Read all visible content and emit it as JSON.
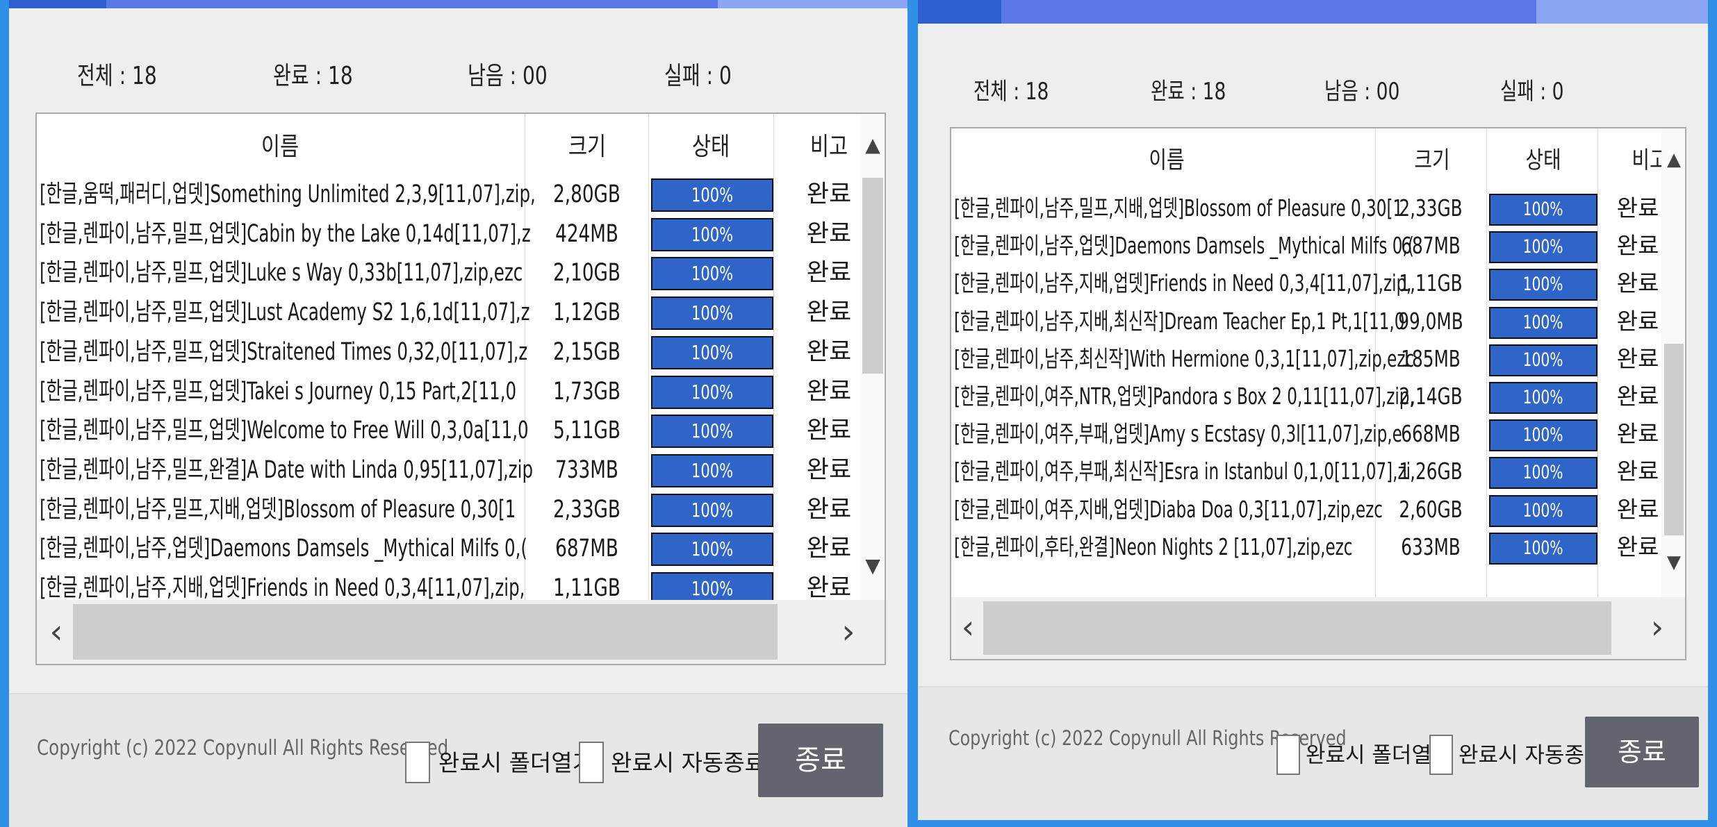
{
  "colors": {
    "accent": "#2f8ee6",
    "progress": "#2f65c8",
    "button": "#62656e"
  },
  "icons": {
    "scroll_up": "▲",
    "scroll_down": "▼",
    "scroll_left": "‹",
    "scroll_right": "›"
  },
  "left": {
    "stats": {
      "total": "전체 : 18",
      "done": "완료 : 18",
      "remain": "남음 : 00",
      "fail": "실패 : 0"
    },
    "columns": {
      "name": "이름",
      "size": "크기",
      "status": "상태",
      "note": "비고"
    },
    "rows": [
      {
        "name": "[한글,움떡,패러디,업뎃]Something Unlimited 2,3,9[11,07],zip,",
        "size": "2,80GB",
        "progress": "100%",
        "note": "완료"
      },
      {
        "name": "[한글,렌파이,남주,밀프,업뎃]Cabin by the Lake 0,14d[11,07],z",
        "size": "424MB",
        "progress": "100%",
        "note": "완료"
      },
      {
        "name": "[한글,렌파이,남주,밀프,업뎃]Luke s Way 0,33b[11,07],zip,ezc",
        "size": "2,10GB",
        "progress": "100%",
        "note": "완료"
      },
      {
        "name": "[한글,렌파이,남주,밀프,업뎃]Lust Academy S2 1,6,1d[11,07],z",
        "size": "1,12GB",
        "progress": "100%",
        "note": "완료"
      },
      {
        "name": "[한글,렌파이,남주,밀프,업뎃]Straitened Times 0,32,0[11,07],z",
        "size": "2,15GB",
        "progress": "100%",
        "note": "완료"
      },
      {
        "name": "[한글,렌파이,남주,밀프,업뎃]Takei s Journey 0,15 Part,2[11,0",
        "size": "1,73GB",
        "progress": "100%",
        "note": "완료"
      },
      {
        "name": "[한글,렌파이,남주,밀프,업뎃]Welcome to Free Will 0,3,0a[11,0",
        "size": "5,11GB",
        "progress": "100%",
        "note": "완료"
      },
      {
        "name": "[한글,렌파이,남주,밀프,완결]A Date with Linda 0,95[11,07],zip",
        "size": "733MB",
        "progress": "100%",
        "note": "완료"
      },
      {
        "name": "[한글,렌파이,남주,밀프,지배,업뎃]Blossom of Pleasure 0,30[1",
        "size": "2,33GB",
        "progress": "100%",
        "note": "완료"
      },
      {
        "name": "[한글,렌파이,남주,업뎃]Daemons Damsels _Mythical Milfs 0,(",
        "size": "687MB",
        "progress": "100%",
        "note": "완료"
      },
      {
        "name": "[한글,렌파이,남주,지배,업뎃]Friends in Need 0,3,4[11,07],zip,",
        "size": "1,11GB",
        "progress": "100%",
        "note": "완료"
      }
    ],
    "footer": {
      "copyright": "Copyright (c) 2022 Copynull All Rights Reserved",
      "open_folder": "완료시 폴더열기",
      "auto_exit": "완료시 자동종료",
      "exit_button": "종료"
    }
  },
  "right": {
    "stats": {
      "total": "전체 : 18",
      "done": "완료 : 18",
      "remain": "남음 : 00",
      "fail": "실패 : 0"
    },
    "columns": {
      "name": "이름",
      "size": "크기",
      "status": "상태",
      "note": "비고"
    },
    "rows": [
      {
        "name": "[한글,렌파이,남주,밀프,지배,업뎃]Blossom of Pleasure 0,30[1",
        "size": "2,33GB",
        "progress": "100%",
        "note": "완료"
      },
      {
        "name": "[한글,렌파이,남주,업뎃]Daemons Damsels _Mythical Milfs 0,(",
        "size": "687MB",
        "progress": "100%",
        "note": "완료"
      },
      {
        "name": "[한글,렌파이,남주,지배,업뎃]Friends in Need 0,3,4[11,07],zip,",
        "size": "1,11GB",
        "progress": "100%",
        "note": "완료"
      },
      {
        "name": "[한글,렌파이,남주,지배,최신작]Dream Teacher Ep,1 Pt,1[11,0",
        "size": "99,0MB",
        "progress": "100%",
        "note": "완료"
      },
      {
        "name": "[한글,렌파이,남주,최신작]With Hermione 0,3,1[11,07],zip,ezc",
        "size": "185MB",
        "progress": "100%",
        "note": "완료"
      },
      {
        "name": "[한글,렌파이,여주,NTR,업뎃]Pandora s Box 2 0,11[11,07],zip,",
        "size": "2,14GB",
        "progress": "100%",
        "note": "완료"
      },
      {
        "name": "[한글,렌파이,여주,부패,업뎃]Amy s Ecstasy 0,3l[11,07],zip,e",
        "size": "668MB",
        "progress": "100%",
        "note": "완료"
      },
      {
        "name": "[한글,렌파이,여주,부패,최신작]Esra in Istanbul 0,1,0[11,07],zi",
        "size": "1,26GB",
        "progress": "100%",
        "note": "완료"
      },
      {
        "name": "[한글,렌파이,여주,지배,업뎃]Diaba Doa 0,3[11,07],zip,ezc",
        "size": "2,60GB",
        "progress": "100%",
        "note": "완료"
      },
      {
        "name": "[한글,렌파이,후타,완결]Neon Nights 2 [11,07],zip,ezc",
        "size": "633MB",
        "progress": "100%",
        "note": "완료"
      }
    ],
    "footer": {
      "copyright": "Copyright (c) 2022 Copynull All Rights Reserved",
      "open_folder": "완료시 폴더열기",
      "auto_exit": "완료시 자동종료",
      "exit_button": "종료"
    }
  }
}
